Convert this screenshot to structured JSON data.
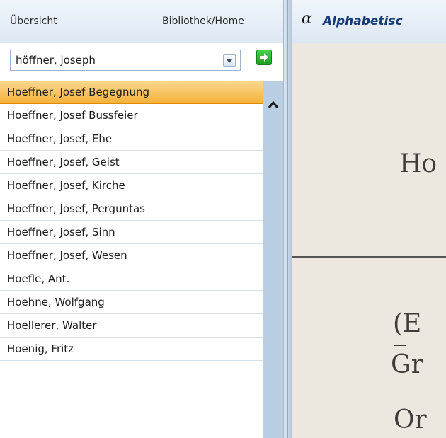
{
  "nav": {
    "overview": "Übersicht",
    "library_home": "Bibliothek/Home"
  },
  "search": {
    "value": "höffner, joseph"
  },
  "list": {
    "items": [
      "Hoeffner, Josef Begegnung",
      "Hoeffner, Josef Bussfeier",
      "Hoeffner, Josef, Ehe",
      "Hoeffner, Josef, Geist",
      "Hoeffner, Josef, Kirche",
      "Hoeffner, Josef, Perguntas",
      "Hoeffner, Josef, Sinn",
      "Hoeffner, Josef, Wesen",
      "Hoefle, Ant.",
      "Hoehne, Wolfgang",
      "Hoellerer, Walter",
      "Hoenig, Fritz"
    ],
    "selected_index": 0
  },
  "viewer": {
    "alpha_symbol": "α",
    "title": "Alphabetisc",
    "scan_lines": [
      "Ho",
      "(E",
      "Gr",
      "Or"
    ]
  },
  "colors": {
    "selection": "#f6b33c",
    "scrollbar": "#b9cde3",
    "title": "#173a78"
  },
  "icons": [
    "dropdown-arrow-icon",
    "go-arrow-icon",
    "scroll-up-icon",
    "alpha-icon"
  ]
}
